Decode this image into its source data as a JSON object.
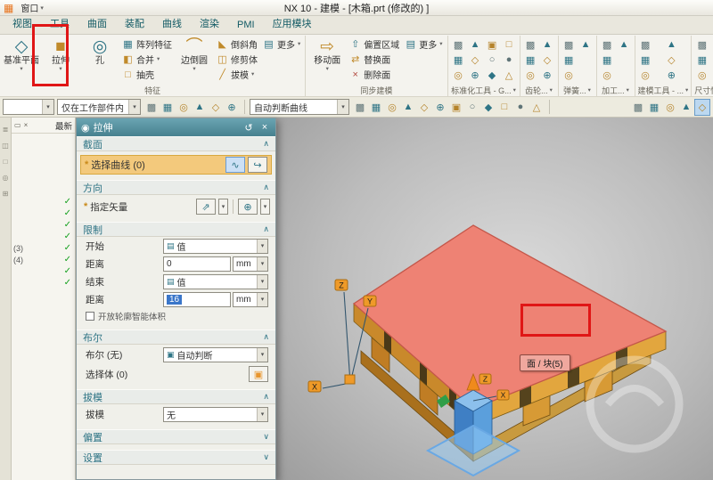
{
  "title_bar": {
    "title": "NX 10 - 建模 - [木箱.prt (修改的) ]",
    "window_menu": "窗口"
  },
  "tabs": [
    "视图",
    "工具",
    "曲面",
    "装配",
    "曲线",
    "渲染",
    "PMI",
    "应用模块"
  ],
  "ribbon": {
    "feature": {
      "label": "特征",
      "datum_plane": "基准平面",
      "extrude": "拉伸",
      "hole": "孔",
      "pattern": "阵列特征",
      "unite": "合并",
      "shell": "抽壳",
      "edge_blend": "边倒圆",
      "chamfer": "倒斜角",
      "trim_body": "修剪体",
      "draft": "拔模",
      "more": "更多"
    },
    "sync": {
      "label": "同步建模",
      "move_face": "移动面",
      "offset_region": "偏置区域",
      "replace_face": "替换面",
      "delete_face": "删除面",
      "more": "更多"
    },
    "icon_groups": [
      {
        "label": "标准化工具 - G...",
        "icons": [
          "clamp-icon",
          "bolt-icon",
          "plate-icon",
          "bracket-icon",
          "pin-icon",
          "slot-icon",
          "washer-icon",
          "rail-icon",
          "block-icon",
          "corner-icon",
          "bushing-icon",
          "spacer-icon"
        ]
      },
      {
        "label": "齿轮...",
        "icons": [
          "cylinder-gear-icon",
          "bevel-gear-icon",
          "gear-pair-icon",
          "worm-gear-icon",
          "rack-icon",
          "gear-tool-icon"
        ]
      },
      {
        "label": "弹簧...",
        "icons": [
          "compression-spring-icon",
          "extension-spring-icon",
          "torsion-spring-icon",
          "leaf-spring-icon"
        ]
      },
      {
        "label": "加工...",
        "icons": [
          "fixture-icon",
          "cutter-icon",
          "toolpath-icon",
          "stock-icon"
        ]
      },
      {
        "label": "建模工具 - ...",
        "icons": [
          "measure-icon",
          "analysis-icon",
          "section-icon",
          "expression-icon",
          "wave-link-icon",
          "simplify-icon"
        ]
      },
      {
        "label": "尺寸快速格式化",
        "icons": [
          "linear-dim-icon",
          "radial-dim-icon",
          "angular-dim-icon",
          "diameter-dim-icon",
          "tolerance-icon",
          "text-style-icon",
          "arrow-style-icon",
          "units-icon",
          "precision-icon"
        ]
      }
    ]
  },
  "toolbar": {
    "type_filter": "",
    "scope": "仅在工作部件内",
    "curve_rule": "自动判断曲线",
    "cluster1": [
      "select-arrow-icon",
      "rectangle-select-icon",
      "lasso-select-icon",
      "snap-settings-icon",
      "highlight-icon",
      "touch-mode-icon"
    ],
    "cluster2": [
      "endpoint-snap-icon",
      "midpoint-snap-icon",
      "arc-snap-icon",
      "circle-snap-icon",
      "center-snap-icon",
      "quadrant-snap-icon",
      "vertex-snap-icon",
      "perpendicular-snap-icon",
      "curve-snap-icon",
      "point-snap-icon",
      "face-snap-icon",
      "angle-snap-icon"
    ],
    "cluster3": [
      "grid-icon",
      "window-icon",
      "center-view-icon",
      "render-style-icon",
      "fit-view-icon"
    ]
  },
  "navigator": {
    "header": "最新",
    "rows": [
      {
        "label": "",
        "check": true
      },
      {
        "label": "",
        "check": true
      },
      {
        "label": "",
        "check": true
      },
      {
        "label": "",
        "check": true
      },
      {
        "label": "(3)",
        "check": true
      },
      {
        "label": "(4)",
        "check": true
      },
      {
        "label": "",
        "check": true
      },
      {
        "label": "",
        "check": true
      }
    ]
  },
  "dialog": {
    "title": "拉伸",
    "sections": {
      "section": "截面",
      "direction": "方向",
      "limits": "限制",
      "boolean": "布尔",
      "draft": "拔模",
      "offset": "偏置",
      "settings": "设置"
    },
    "required_marker": "*",
    "select_curve": "选择曲线 (0)",
    "specify_vector": "指定矢量",
    "start_label": "开始",
    "start_option": "值",
    "distance1_label": "距离",
    "distance1_value": "0",
    "distance1_unit": "mm",
    "end_label": "结束",
    "end_option": "值",
    "distance2_label": "距离",
    "distance2_value": "16",
    "distance2_unit": "mm",
    "open_profile": "开放轮廓智能体积",
    "boolean_label": "布尔 (无)",
    "boolean_option": "自动判断",
    "select_body": "选择体 (0)",
    "draft_label": "拔模",
    "draft_option": "无"
  },
  "viewport": {
    "tooltip": "面 / 块(5)",
    "wcs_x": "X",
    "wcs_y": "Y",
    "wcs_z": "Z",
    "csys_x": "X",
    "csys_z": "Z"
  }
}
